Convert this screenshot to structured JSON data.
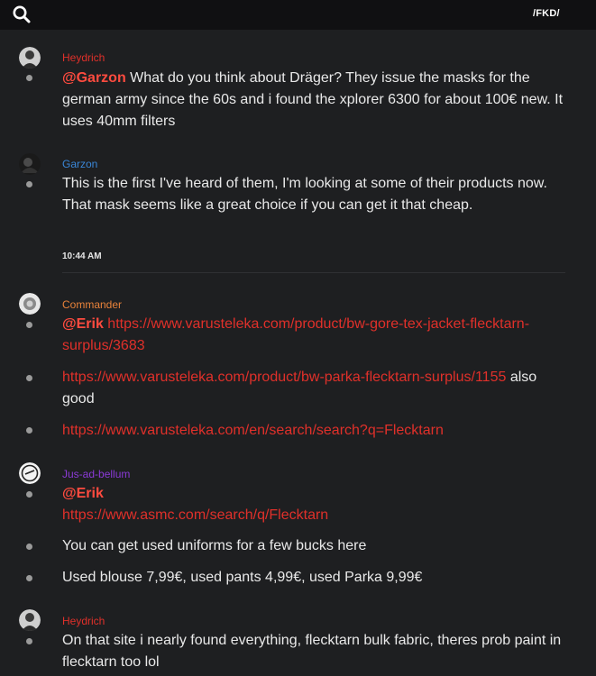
{
  "header": {
    "server": "/FKD/",
    "search_icon": "search-icon"
  },
  "colors": {
    "background": "#1e1f21",
    "topbar": "#101012",
    "link": "#e0302a",
    "mention": "#ff4b3f",
    "heydrich": "#e0302a",
    "garzon": "#3a86d6",
    "commander": "#e8823a",
    "jus": "#8a3ad6"
  },
  "messages": [
    {
      "author": "Heydrich",
      "mention": "@Garzon",
      "lines": [
        "What do you think about Dräger? They issue the masks for the",
        "german army since the 60s and i found the xplorer 6300 for about 100€ new. It",
        "uses 40mm filters"
      ]
    },
    {
      "author": "Garzon",
      "lines": [
        "This is the first I've heard of them, I'm looking at some of their products now.",
        "That mask seems like a great choice if you can get it that cheap."
      ]
    },
    {
      "timestamp": "10:44 AM"
    },
    {
      "author": "Commander",
      "mention": "@Erik",
      "link1a": "https://www.varusteleka.com/product/bw-gore-tex-jacket-flecktarn-",
      "link1b": "surplus/3683",
      "link2": "https://www.varusteleka.com/product/bw-parka-flecktarn-surplus/1155",
      "link2_tail": "also",
      "link2_tail2": "good",
      "link3": "https://www.varusteleka.com/en/search/search?q=Flecktarn"
    },
    {
      "author": "Jus-ad-bellum",
      "mention": "@Erik",
      "link": "https://www.asmc.com/search/q/Flecktarn",
      "line2": "You can get used uniforms for a few bucks here",
      "line3": "Used blouse 7,99€, used pants 4,99€, used Parka 9,99€"
    },
    {
      "author": "Heydrich",
      "lines": [
        "On that site i nearly found everything, flecktarn bulk fabric, theres prob paint in",
        "flecktarn too lol"
      ]
    }
  ]
}
